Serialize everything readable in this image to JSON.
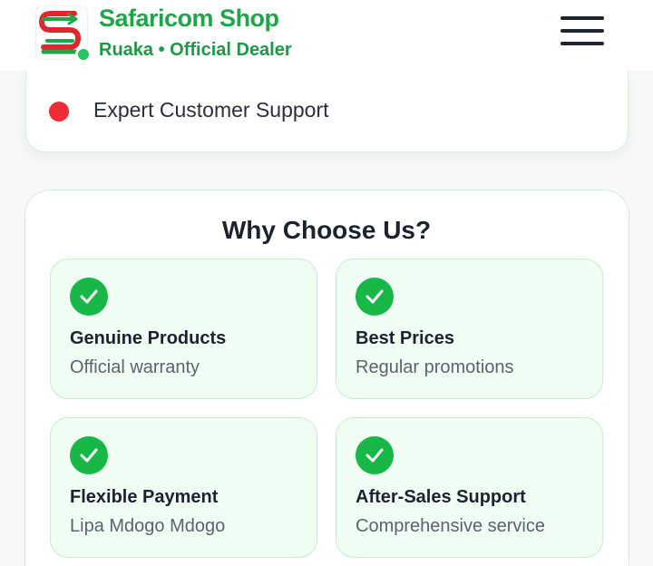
{
  "header": {
    "brand_name": "Safaricom Shop",
    "brand_subtitle": "Ruaka • Official Dealer",
    "logo_icon": "safaricom-s-logo-icon",
    "menu_icon": "hamburger-menu-icon"
  },
  "support": {
    "label": "Expert Customer Support",
    "dot_color": "#ef2b36"
  },
  "why": {
    "title": "Why Choose Us?",
    "features": [
      {
        "title": "Genuine Products",
        "subtitle": "Official warranty",
        "icon": "check-icon"
      },
      {
        "title": "Best Prices",
        "subtitle": "Regular promotions",
        "icon": "check-icon"
      },
      {
        "title": "Flexible Payment",
        "subtitle": "Lipa Mdogo Mdogo",
        "icon": "check-icon"
      },
      {
        "title": "After-Sales Support",
        "subtitle": "Comprehensive service",
        "icon": "check-icon"
      }
    ]
  },
  "colors": {
    "brand_green": "#1fa64a",
    "check_green": "#17b847",
    "feature_bg": "#f0fdf3"
  }
}
